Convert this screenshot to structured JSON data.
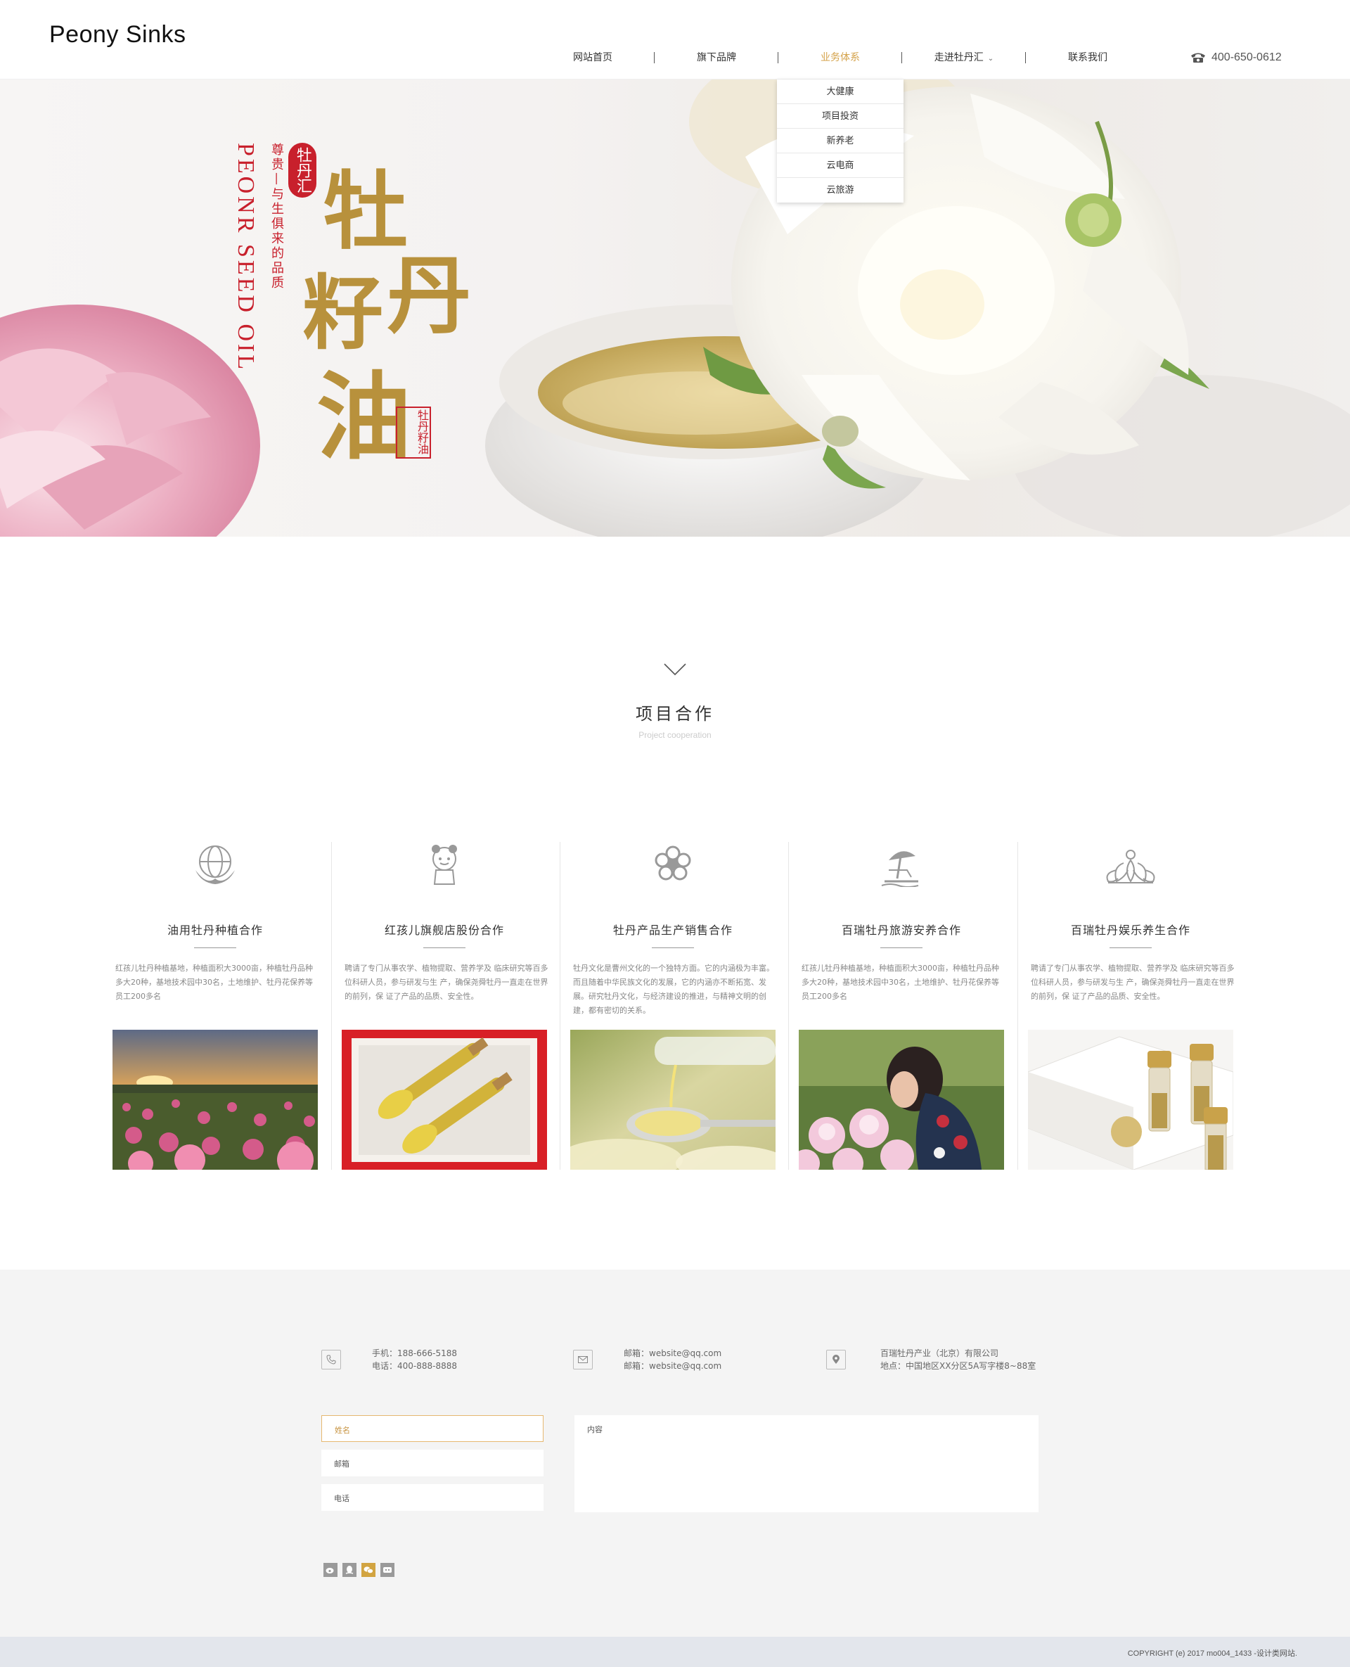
{
  "header": {
    "logo": "Peony Sinks",
    "nav": [
      {
        "label": "网站首页"
      },
      {
        "label": "旗下品牌"
      },
      {
        "label": "业务体系"
      },
      {
        "label": "走进牡丹汇"
      },
      {
        "label": "联系我们"
      }
    ],
    "phone": "400-650-0612",
    "accent_color": "#d4a24a"
  },
  "dropdown": {
    "items": [
      "大健康",
      "项目投资",
      "新养老",
      "云电商",
      "云旅游"
    ]
  },
  "hero": {
    "brand_seal": "牡丹汇",
    "tagline": "尊贵—与生俱来的品质",
    "english": "PEONR SEED OIL",
    "calligraphy": [
      "牡",
      "丹",
      "籽",
      "油"
    ],
    "stamp": "牡丹籽油",
    "seal_color": "#c8202c",
    "gold_color": "#b8913c"
  },
  "project": {
    "title": "项目合作",
    "subtitle": "Project cooperation",
    "cards": [
      {
        "icon": "globe-icon",
        "title": "油用牡丹种植合作",
        "text": "红孩儿牡丹种植基地，种植面积大3000亩，种植牡丹品种多大20种，基地技术园中30名，土地维护、牡丹花保养等员工200多名"
      },
      {
        "icon": "mascot-icon",
        "title": "红孩儿旗舰店股份合作",
        "text": "聘请了专门从事农学、植物提取、营养学及 临床研究等百多位科研人员，参与研发与生 产，确保尧舜牡丹一直走在世界的前列，保 证了产品的品质、安全性。"
      },
      {
        "icon": "peony-icon",
        "title": "牡丹产品生产销售合作",
        "text": "牡丹文化是曹州文化的一个独特方面。它的内涵极为丰富。而且随着中华民族文化的发展，它的内涵亦不断拓宽、发展。研究牡丹文化，与经济建设的推进，与精神文明的创建，都有密切的关系。"
      },
      {
        "icon": "beach-umbrella-icon",
        "title": "百瑞牡丹旅游安养合作",
        "text": "红孩儿牡丹种植基地，种植面积大3000亩，种植牡丹品种多大20种，基地技术园中30名，土地维护、牡丹花保养等员工200多名"
      },
      {
        "icon": "lotus-icon",
        "title": "百瑞牡丹娱乐养生合作",
        "text": "聘请了专门从事农学、植物提取、营养学及 临床研究等百多位科研人员，参与研发与生 产，确保尧舜牡丹一直走在世界的前列，保 证了产品的品质、安全性。"
      }
    ]
  },
  "contact": {
    "phone_lines": [
      "手机：188-666-5188",
      "电话：400-888-8888"
    ],
    "email_lines": [
      "邮箱：website@qq.com",
      "邮箱：website@qq.com"
    ],
    "address_lines": [
      "百瑞牡丹产业（北京）有限公司",
      "地点：中国地区XX分区5A写字楼8~88室"
    ],
    "form": {
      "name": "姓名",
      "email": "邮箱",
      "phone": "电话",
      "content": "内容"
    },
    "social": [
      "weibo-icon",
      "qq-icon",
      "wechat-icon",
      "tencent-weibo-icon"
    ]
  },
  "footer": {
    "copyright": "COPYRIGHT (e) 2017 mo004_1433 -设计类网站."
  }
}
